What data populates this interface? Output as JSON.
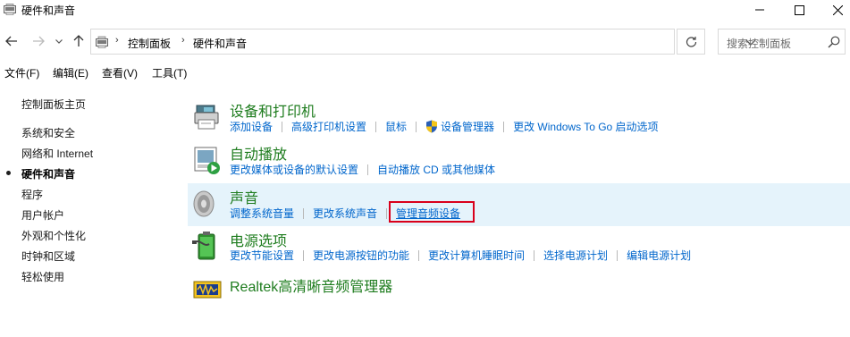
{
  "window": {
    "title": "硬件和声音",
    "controls": {
      "minimize": "minimize-icon",
      "maximize": "maximize-icon",
      "close": "close-icon"
    }
  },
  "nav": {
    "back": "back-arrow-icon",
    "forward": "forward-arrow-icon",
    "recent": "chevron-down-icon",
    "up": "up-arrow-icon"
  },
  "address": {
    "breadcrumbs": [
      "控制面板",
      "硬件和声音"
    ],
    "search_placeholder": "搜索控制面板"
  },
  "menu": [
    "文件(F)",
    "编辑(E)",
    "查看(V)",
    "工具(T)"
  ],
  "sidebar": {
    "home": "控制面板主页",
    "items": [
      {
        "label": "系统和安全",
        "current": false
      },
      {
        "label": "网络和 Internet",
        "current": false
      },
      {
        "label": "硬件和声音",
        "current": true
      },
      {
        "label": "程序",
        "current": false
      },
      {
        "label": "用户帐户",
        "current": false
      },
      {
        "label": "外观和个性化",
        "current": false
      },
      {
        "label": "时钟和区域",
        "current": false
      },
      {
        "label": "轻松使用",
        "current": false
      }
    ]
  },
  "categories": [
    {
      "title": "设备和打印机",
      "icon": "printer-icon",
      "links": [
        "添加设备",
        "高级打印机设置",
        "鼠标",
        "设备管理器",
        "更改 Windows To Go 启动选项"
      ]
    },
    {
      "title": "自动播放",
      "icon": "autoplay-icon",
      "links": [
        "更改媒体或设备的默认设置",
        "自动播放 CD 或其他媒体"
      ]
    },
    {
      "title": "声音",
      "icon": "speaker-icon",
      "links": [
        "调整系统音量",
        "更改系统声音",
        "管理音频设备"
      ]
    },
    {
      "title": "电源选项",
      "icon": "power-battery-icon",
      "links": [
        "更改节能设置",
        "更改电源按钮的功能",
        "更改计算机睡眠时间",
        "选择电源计划",
        "编辑电源计划"
      ]
    },
    {
      "title": "Realtek高清晰音频管理器",
      "icon": "realtek-audio-icon",
      "links": []
    }
  ],
  "colors": {
    "category_title": "#1e7c1e",
    "link": "#0066cc",
    "highlight_bg": "#e5f3fb",
    "annotation_box": "#d9001b"
  }
}
